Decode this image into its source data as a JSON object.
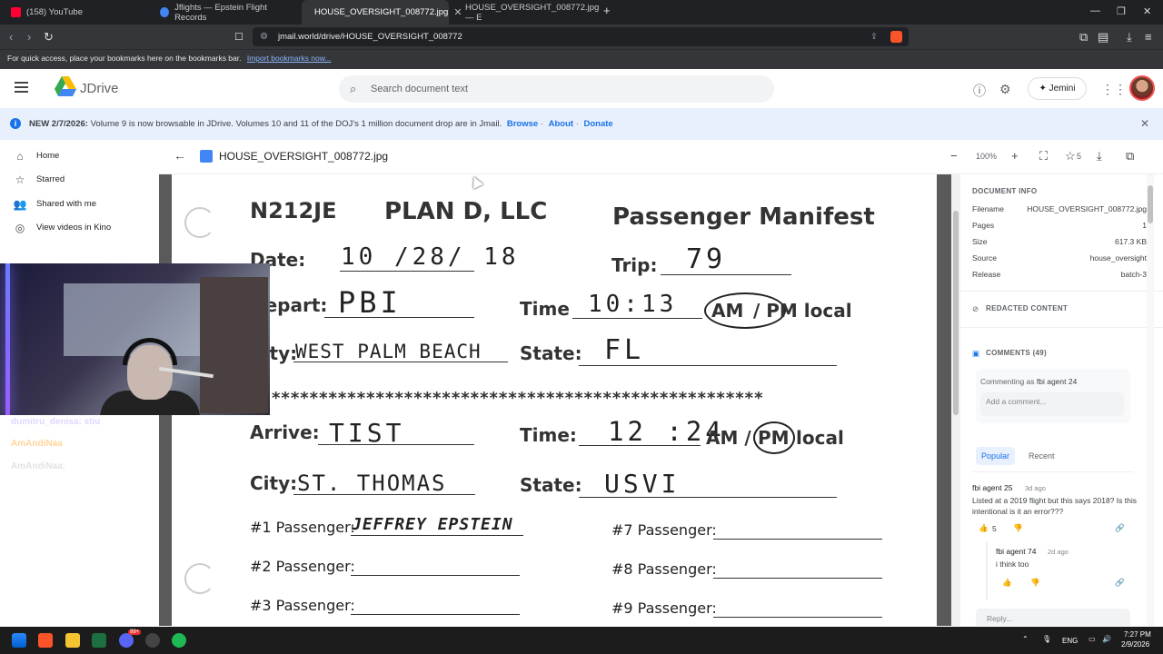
{
  "browser": {
    "tabs": [
      {
        "label": "(158) YouTube",
        "color": "#ff0033"
      },
      {
        "label": "Jflights — Epstein Flight Records",
        "color": "#4285f4"
      },
      {
        "label": "HOUSE_OVERSIGHT_008772.jpg",
        "color": "#34a853"
      },
      {
        "label": "HOUSE_OVERSIGHT_008772.jpg — E",
        "color": "#34a853"
      }
    ],
    "url": "jmail.world/drive/HOUSE_OVERSIGHT_008772",
    "bookmarks_text": "For quick access, place your bookmarks here on the bookmarks bar.",
    "bookmarks_link": "Import bookmarks now..."
  },
  "app": {
    "name": "JDrive",
    "search_placeholder": "Search document text",
    "assistant_label": "Jemini"
  },
  "banner": {
    "date": "NEW 2/7/2026:",
    "text": " Volume 9 is now browsable in JDrive. Volumes 10 and 11 of the DOJ's 1 million document drop are in Jmail.",
    "links": [
      "Browse",
      "About",
      "Donate"
    ]
  },
  "sidebar": {
    "items": [
      {
        "label": "Home",
        "icon": "home-icon"
      },
      {
        "label": "Starred",
        "icon": "star-icon"
      },
      {
        "label": "Shared with me",
        "icon": "people-icon"
      },
      {
        "label": "View videos in Kino",
        "icon": "globe-icon"
      }
    ]
  },
  "viewer": {
    "filename": "HOUSE_OVERSIGHT_008772.jpg",
    "zoom": "100%",
    "stars": "5"
  },
  "document": {
    "tail_number": "N212JE",
    "company": "PLAN D, LLC",
    "form_title": "Passenger Manifest",
    "date_label": "Date:",
    "date_value": "10 /28/ 18",
    "trip_label": "Trip:",
    "trip_value": "79",
    "depart_label": "Depart:",
    "depart_value": "PBI",
    "time_label": "Time",
    "depart_time": "10:13",
    "am_label": "AM",
    "pm_local_label": "/ PM local",
    "city_label": "City:",
    "depart_city": "WEST PALM BEACH",
    "state_label": "State:",
    "depart_state": "FL",
    "stars_line": "****************************************************",
    "arrive_label": "Arrive:",
    "arrive_value": "TIST",
    "arrive_time_label": "Time:",
    "arrive_time": "12 :24",
    "am_slash": "AM /",
    "pm_label": "PM",
    "local_label": "local",
    "arrive_city_label": "City:",
    "arrive_city": "ST. THOMAS",
    "arrive_state_label": "State:",
    "arrive_state": "USVI",
    "passengers": [
      {
        "label": "#1 Passenger:",
        "name": "JEFFREY EPSTEIN"
      },
      {
        "label": "#2 Passenger:",
        "name": ""
      },
      {
        "label": "#3 Passenger:",
        "name": ""
      },
      {
        "label": "#7 Passenger:",
        "name": ""
      },
      {
        "label": "#8 Passenger:",
        "name": ""
      },
      {
        "label": "#9 Passenger:",
        "name": ""
      }
    ]
  },
  "doc_info": {
    "heading": "DOCUMENT INFO",
    "rows": [
      {
        "label": "Filename",
        "value": "HOUSE_OVERSIGHT_008772.jpg"
      },
      {
        "label": "Pages",
        "value": "1"
      },
      {
        "label": "Size",
        "value": "617.3 KB"
      },
      {
        "label": "Source",
        "value": "house_oversight"
      },
      {
        "label": "Release",
        "value": "batch-3"
      }
    ],
    "redacted_heading": "REDACTED CONTENT"
  },
  "comments": {
    "heading": "COMMENTS (49)",
    "commenting_as": "Commenting as ",
    "commenting_user": "fbi agent 24",
    "placeholder": "Add a comment...",
    "tabs": [
      "Popular",
      "Recent"
    ],
    "items": [
      {
        "author": "fbi agent 25",
        "age": "3d ago",
        "text": "Listed at a 2019 flight but this says 2018? Is this intentional is it an error???",
        "likes": "5"
      },
      {
        "author": "fbi agent 74",
        "age": "2d ago",
        "text": "i think too",
        "likes": ""
      }
    ],
    "reply_placeholder": "Reply..."
  },
  "overlay": {
    "names": [
      "dumitru_denisa: stiu",
      "AmAndiNaa",
      "AmAndiNaa:"
    ]
  },
  "taskbar": {
    "lang": "ENG",
    "time": "7:27 PM",
    "date": "2/9/2026",
    "badge": "99+"
  }
}
